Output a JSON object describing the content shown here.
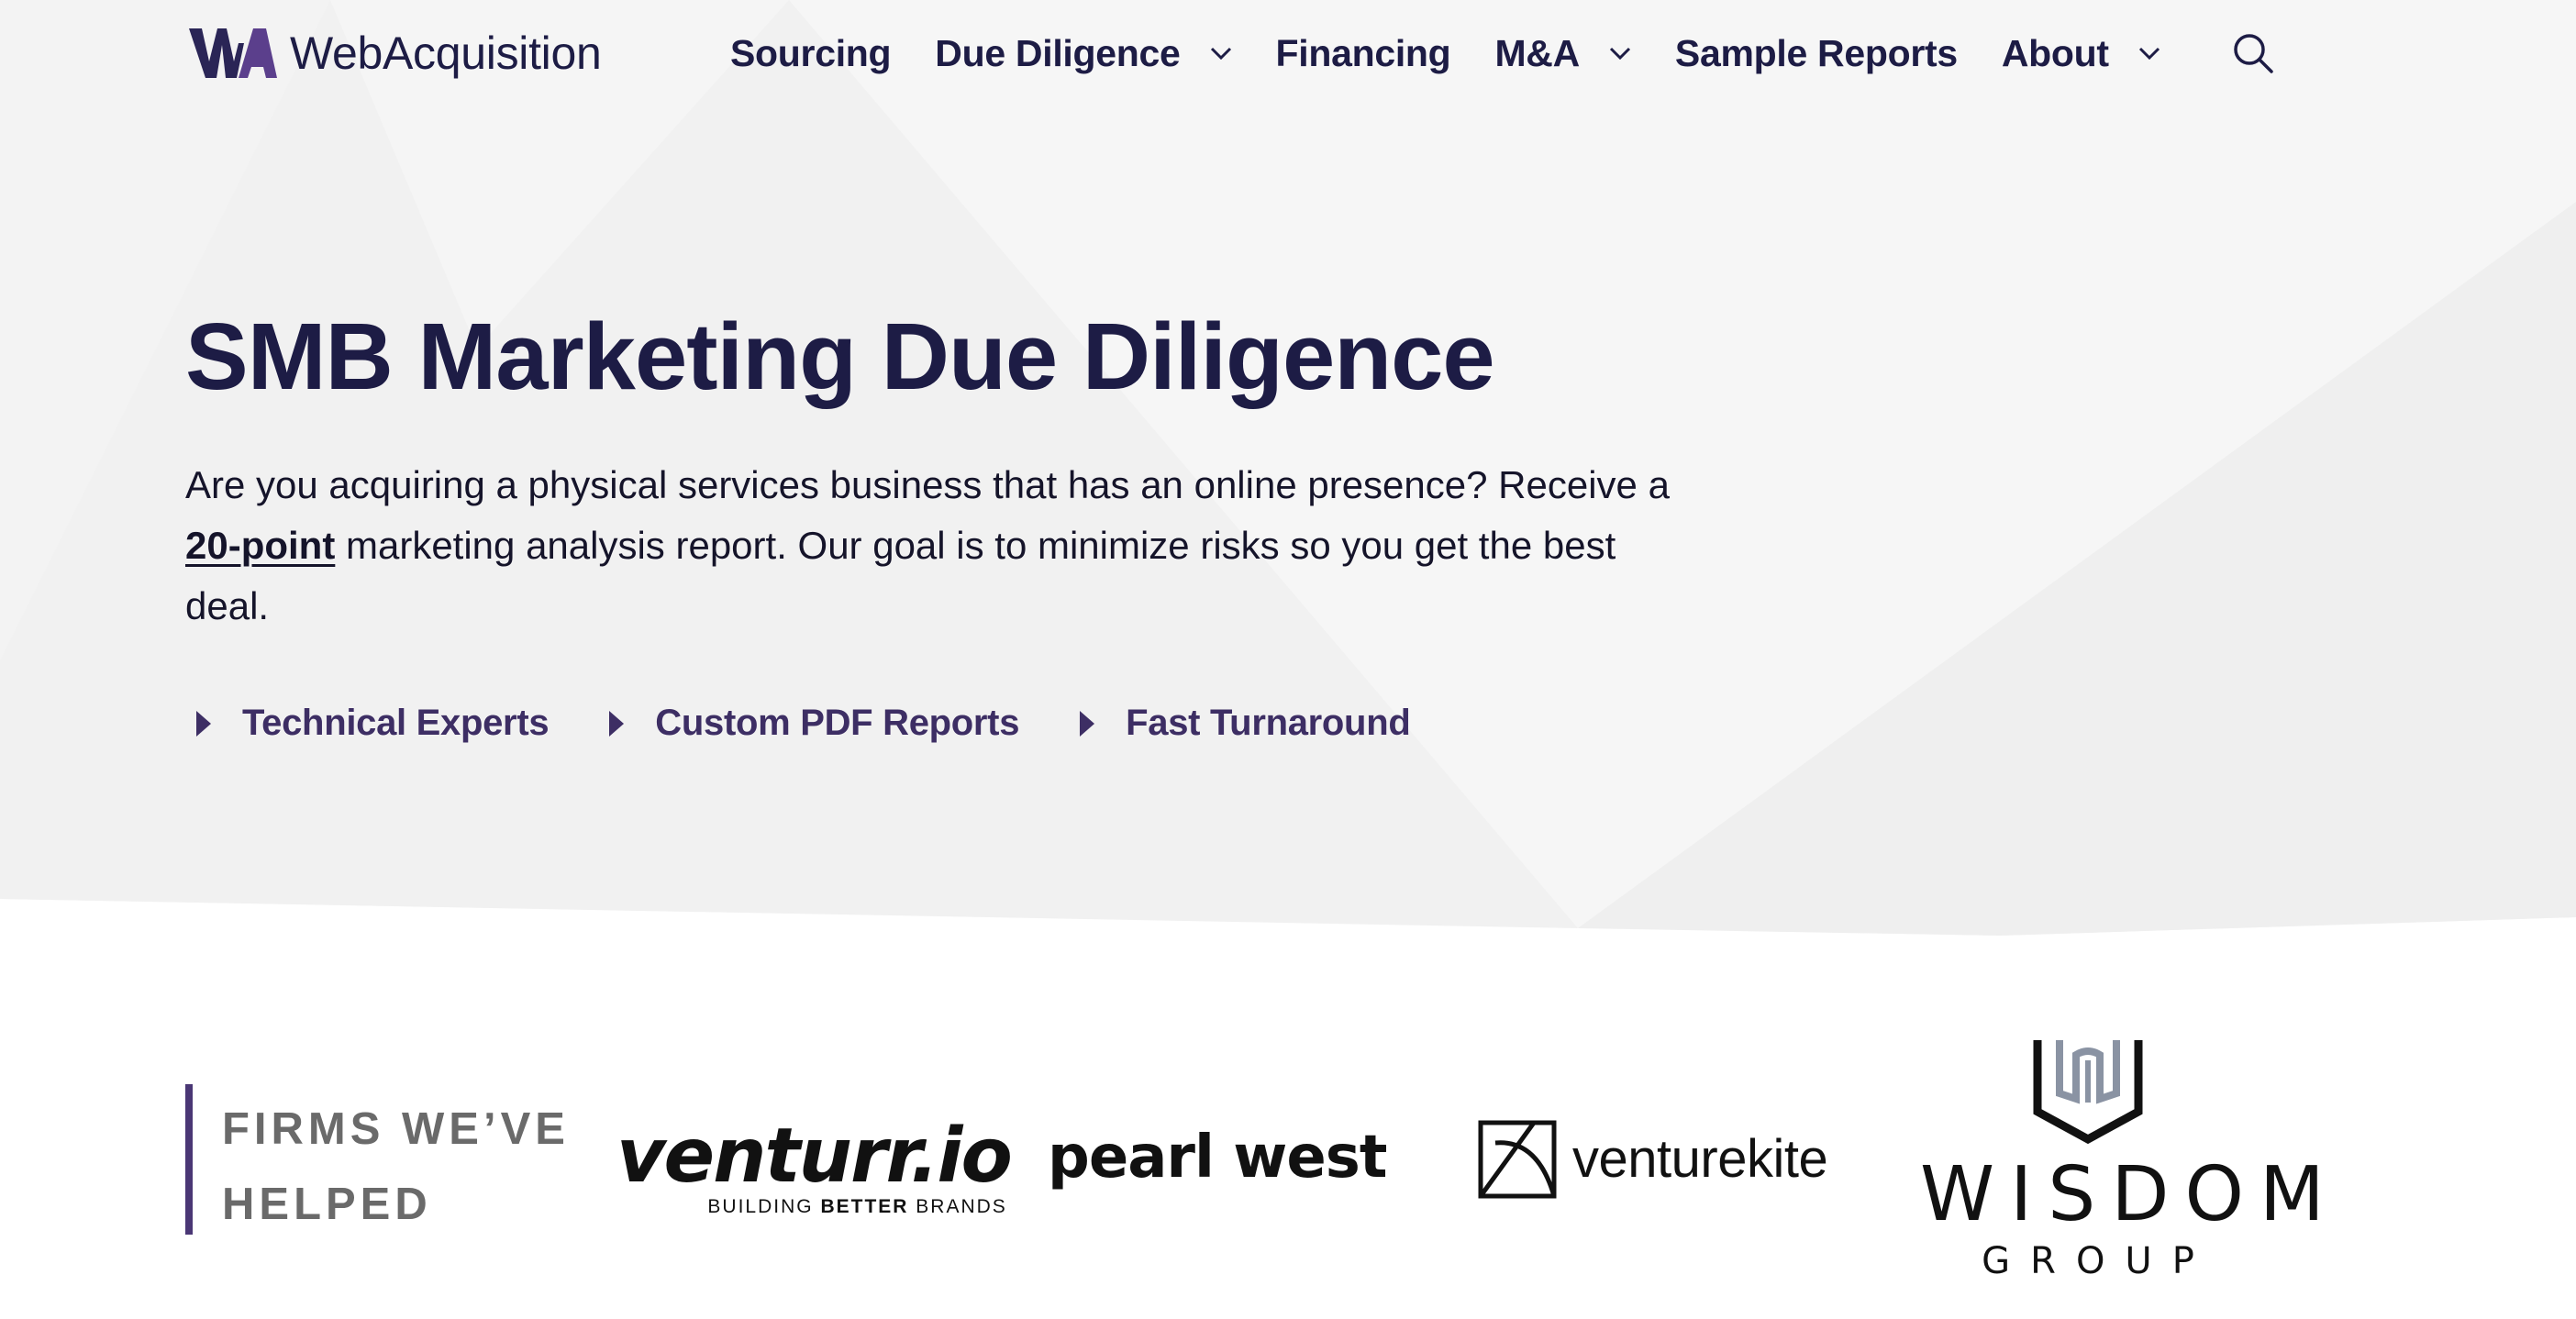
{
  "brand": {
    "name": "WebAcquisition",
    "mark_letters": "WA",
    "colors": {
      "navy": "#1d1c45",
      "purple": "#4a3775",
      "text": "#15142a"
    }
  },
  "nav": {
    "items": [
      {
        "label": "Sourcing",
        "has_dropdown": false
      },
      {
        "label": "Due Diligence",
        "has_dropdown": true
      },
      {
        "label": "Financing",
        "has_dropdown": false
      },
      {
        "label": "M&A",
        "has_dropdown": true
      },
      {
        "label": "Sample Reports",
        "has_dropdown": false
      },
      {
        "label": "About",
        "has_dropdown": true
      }
    ],
    "search_icon": "search-icon"
  },
  "hero": {
    "title": "SMB Marketing Due Diligence",
    "desc_before": "Are you acquiring a physical services business that has an online presence? Receive a ",
    "desc_link": "20-point",
    "desc_after": " marketing analysis report. Our goal is to minimize risks so you get the best deal.",
    "features": [
      {
        "label": "Technical Experts",
        "icon": "caret-right-icon"
      },
      {
        "label": "Custom PDF Reports",
        "icon": "caret-right-icon"
      },
      {
        "label": "Fast Turnaround",
        "icon": "caret-right-icon"
      }
    ]
  },
  "firms": {
    "label": "FIRMS WE’VE HELPED",
    "logos": {
      "venturr": {
        "name": "venturr.io",
        "tagline_pre": "BUILDING ",
        "tagline_bold": "BETTER",
        "tagline_post": " BRANDS"
      },
      "pearl_west": {
        "name": "pearl west"
      },
      "venturekite": {
        "name": "venturekite"
      },
      "wisdom": {
        "name": "WISDOM",
        "sub": "GROUP"
      }
    }
  }
}
